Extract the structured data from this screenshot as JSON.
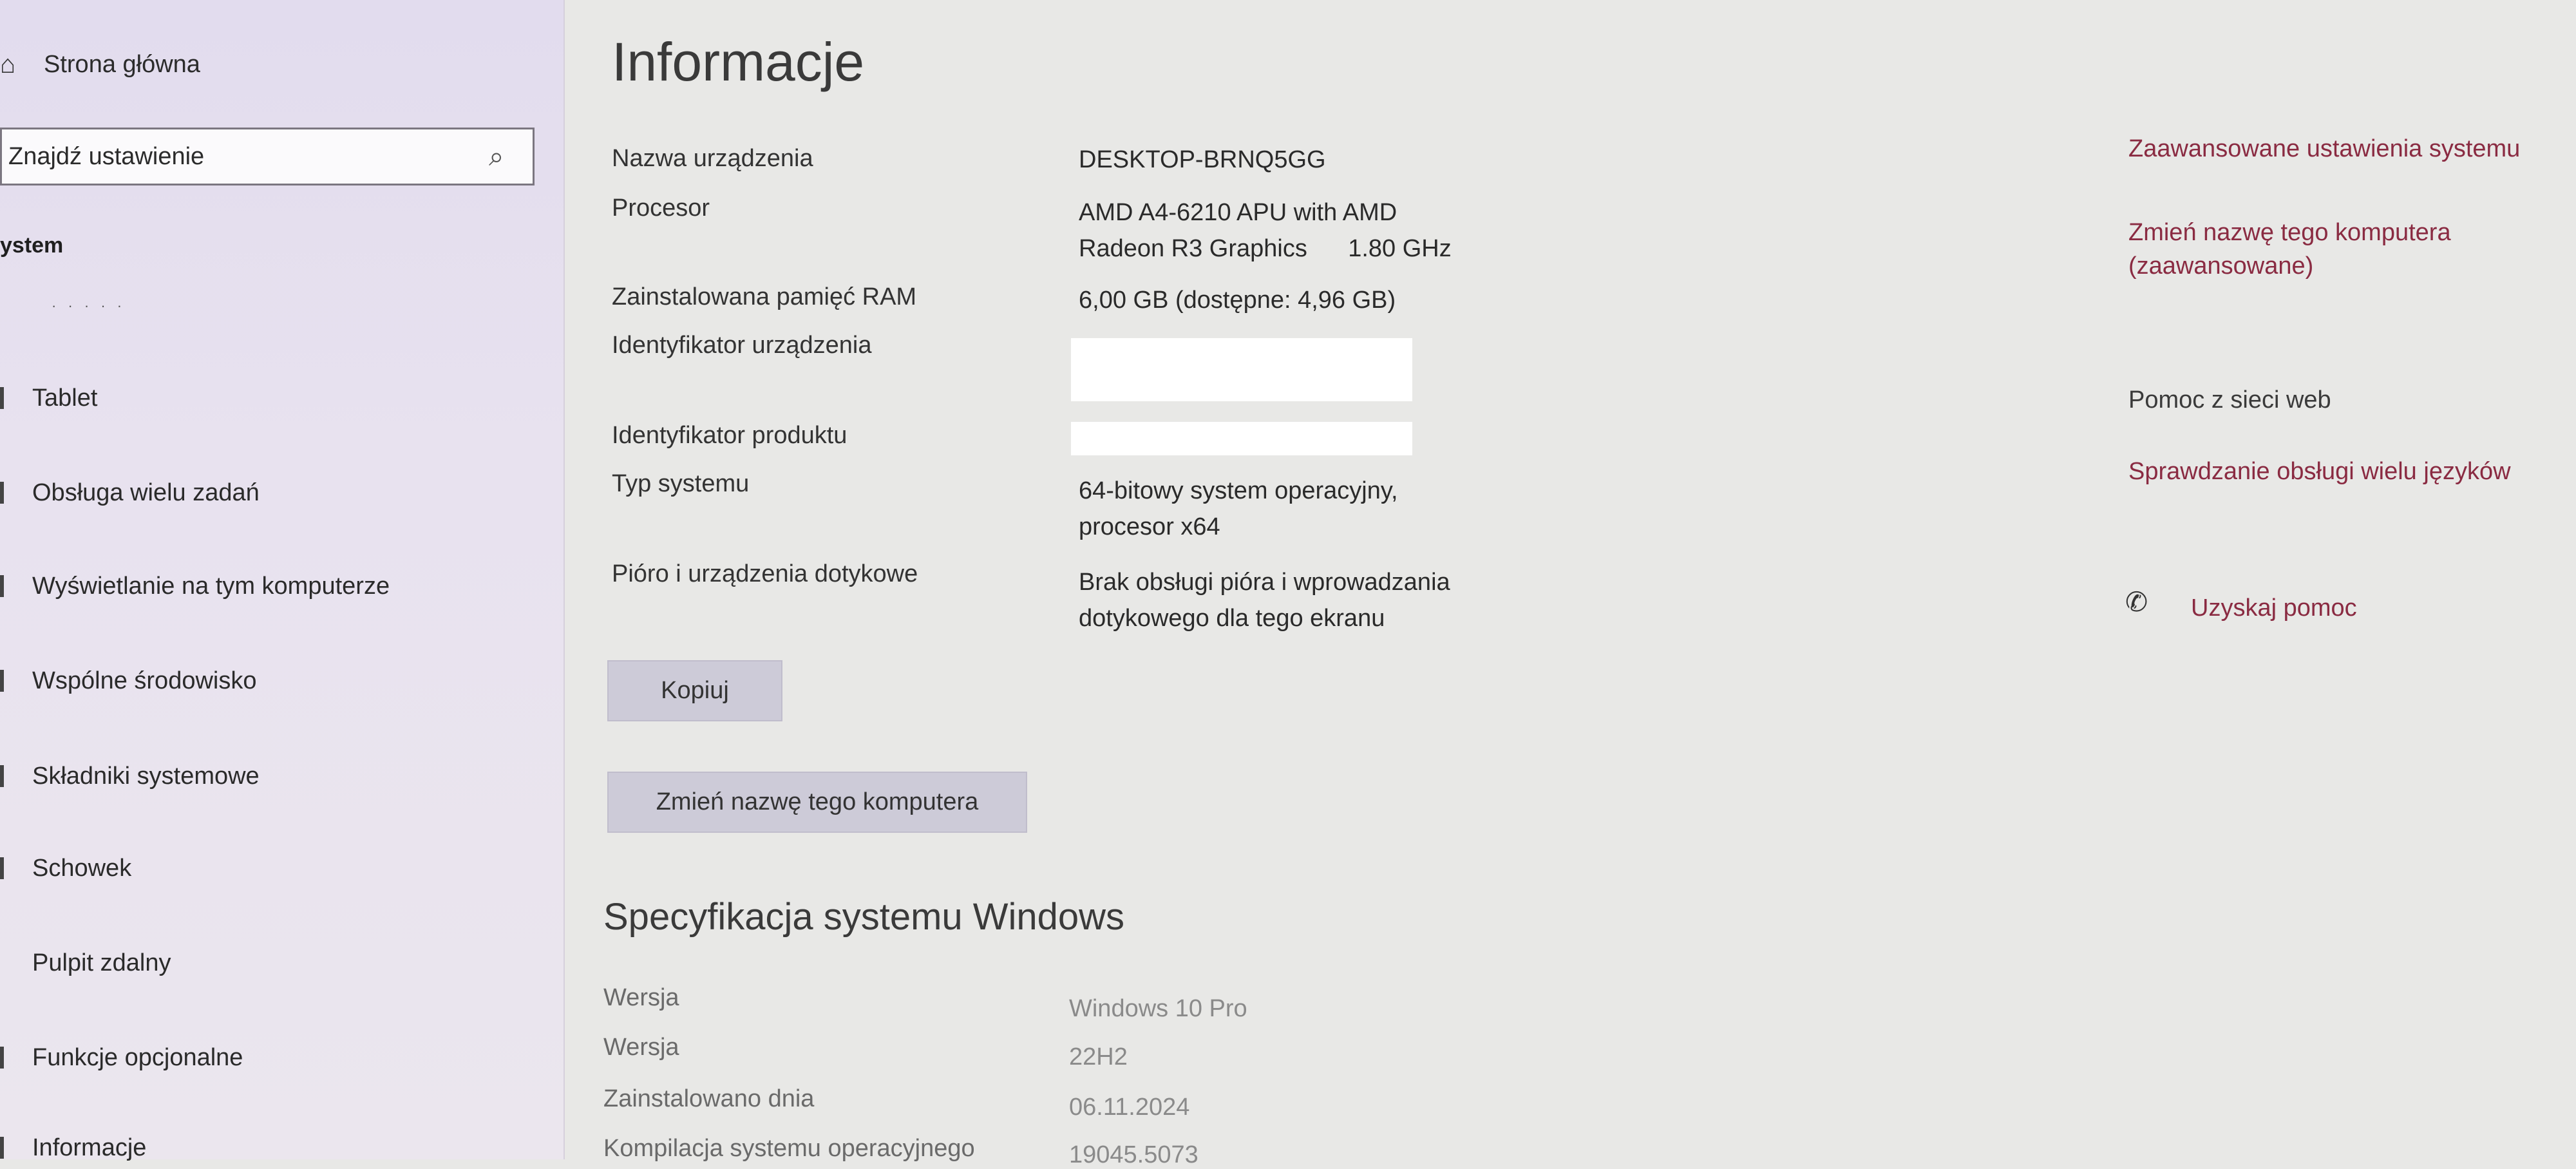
{
  "sidebar": {
    "home_label": "Strona główna",
    "search_placeholder": "Znajdź ustawienie",
    "section_label": "ystem",
    "items": [
      {
        "label": "Tablet"
      },
      {
        "label": "Obsługa wielu zadań"
      },
      {
        "label": "Wyświetlanie na tym komputerze"
      },
      {
        "label": "Wspólne środowisko"
      },
      {
        "label": "Składniki systemowe"
      },
      {
        "label": "Schowek"
      },
      {
        "label": "Pulpit zdalny"
      },
      {
        "label": "Funkcje opcjonalne"
      },
      {
        "label": "Informacje"
      }
    ]
  },
  "main": {
    "title": "Informacje",
    "rows": [
      {
        "label": "Nazwa urządzenia",
        "value": "DESKTOP-BRNQ5GG"
      },
      {
        "label": "Procesor",
        "value": "AMD A4-6210 APU with AMD\nRadeon R3 Graphics      1.80 GHz"
      },
      {
        "label": "Zainstalowana pamięć RAM",
        "value": "6,00 GB (dostępne: 4,96 GB)"
      },
      {
        "label": "Identyfikator urządzenia",
        "value": ""
      },
      {
        "label": "Identyfikator produktu",
        "value": ""
      },
      {
        "label": "Typ systemu",
        "value": "64-bitowy system operacyjny,\nprocesor x64"
      },
      {
        "label": "Pióro i urządzenia dotykowe",
        "value": "Brak obsługi pióra i wprowadzania\ndotykowego dla tego ekranu"
      }
    ],
    "copy_button": "Kopiuj",
    "rename_button": "Zmień nazwę tego komputera",
    "spec_title": "Specyfikacja systemu Windows",
    "spec_rows": [
      {
        "label": "Wersja",
        "value": "Windows 10 Pro"
      },
      {
        "label": "Wersja",
        "value": "22H2"
      },
      {
        "label": "Zainstalowano dnia",
        "value": "06.11.2024"
      },
      {
        "label": "Kompilacja systemu operacyjnego",
        "value": "19045.5073"
      }
    ]
  },
  "related": {
    "advanced_settings": "Zaawansowane ustawienia systemu",
    "rename_advanced": "Zmień nazwę tego komputera\n(zaawansowane)",
    "web_help": "Pomoc z sieci web",
    "multilang": "Sprawdzanie obsługi wielu języków",
    "get_help": "Uzyskaj pomoc"
  },
  "icons": {
    "home": "home-icon",
    "search": "search-icon",
    "help": "help-chat-icon"
  }
}
